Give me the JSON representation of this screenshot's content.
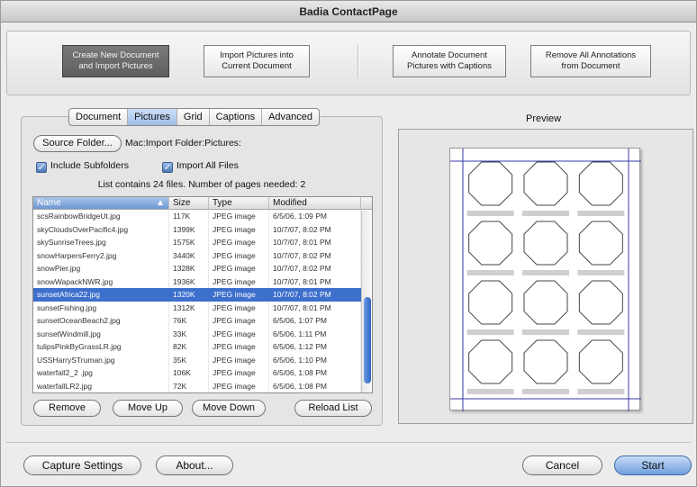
{
  "window": {
    "title": "Badia ContactPage"
  },
  "toolbar": {
    "create": "Create New Document\nand Import Pictures",
    "import": "Import Pictures into\nCurrent Document",
    "annotate": "Annotate Document\nPictures with Captions",
    "remove_all": "Remove All Annotations\nfrom Document"
  },
  "tabs": [
    "Document",
    "Pictures",
    "Grid",
    "Captions",
    "Advanced"
  ],
  "selected_tab": "Pictures",
  "source": {
    "button_label": "Source Folder...",
    "path": "Mac:Import Folder:Pictures:"
  },
  "options": {
    "include_subfolders": "Include Subfolders",
    "import_all": "Import All Files"
  },
  "info_text": "List contains 24 files. Number of pages needed: 2",
  "table": {
    "headers": [
      "Name",
      "Size",
      "Type",
      "Modified"
    ],
    "rows": [
      [
        "scsRainbowBridgeUt.jpg",
        "117K",
        "JPEG image",
        "6/5/06, 1:09 PM"
      ],
      [
        "skyCloudsOverPacific4.jpg",
        "1399K",
        "JPEG image",
        "10/7/07, 8:02 PM"
      ],
      [
        "skySunriseTrees.jpg",
        "1575K",
        "JPEG image",
        "10/7/07, 8:01 PM"
      ],
      [
        "snowHarpersFerry2.jpg",
        "3440K",
        "JPEG image",
        "10/7/07, 8:02 PM"
      ],
      [
        "snowPier.jpg",
        "1328K",
        "JPEG image",
        "10/7/07, 8:02 PM"
      ],
      [
        "snowWapackNWR.jpg",
        "1936K",
        "JPEG image",
        "10/7/07, 8:01 PM"
      ],
      [
        "sunsetAfrica22.jpg",
        "1320K",
        "JPEG image",
        "10/7/07, 8:02 PM"
      ],
      [
        "sunsetFishing.jpg",
        "1312K",
        "JPEG image",
        "10/7/07, 8:01 PM"
      ],
      [
        "sunsetOceanBeach2.jpg",
        "76K",
        "JPEG image",
        "6/5/06, 1:07 PM"
      ],
      [
        "sunsetWindmill.jpg",
        "33K",
        "JPEG image",
        "6/5/06, 1:11 PM"
      ],
      [
        "tulipsPinkByGrassLR.jpg",
        "82K",
        "JPEG image",
        "6/5/06, 1:12 PM"
      ],
      [
        "USSHarrySTruman.jpg",
        "35K",
        "JPEG image",
        "6/5/06, 1:10 PM"
      ],
      [
        "waterfall2_2 .jpg",
        "106K",
        "JPEG image",
        "6/5/06, 1:08 PM"
      ],
      [
        "waterfallLR2.jpg",
        "72K",
        "JPEG image",
        "6/5/06, 1:08 PM"
      ]
    ],
    "selected_row": 6
  },
  "list_buttons": {
    "remove": "Remove",
    "move_up": "Move Up",
    "move_down": "Move Down",
    "reload": "Reload List"
  },
  "preview": {
    "label": "Preview",
    "grid_cols": 3,
    "grid_rows": 4
  },
  "bottom": {
    "capture": "Capture Settings",
    "about": "About...",
    "cancel": "Cancel",
    "start": "Start"
  },
  "colors": {
    "selection": "#3d6fcc",
    "default_button": "#6f9fe0",
    "active_toolbar": "#6a6a6a"
  }
}
